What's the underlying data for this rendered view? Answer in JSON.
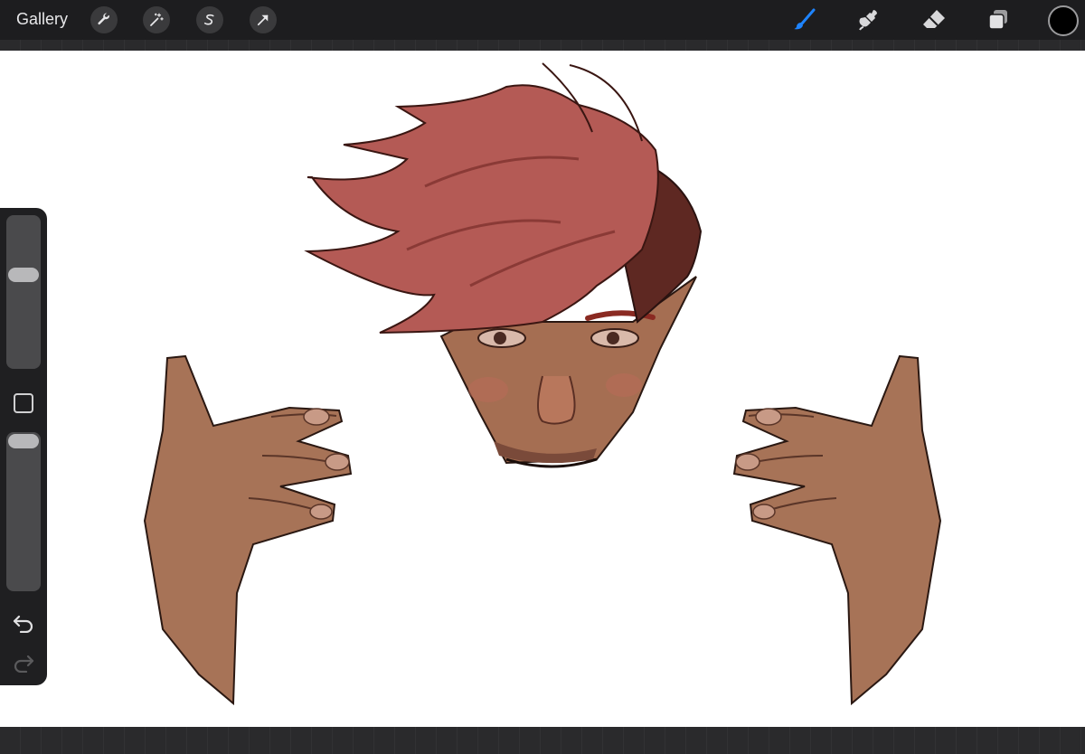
{
  "toolbar": {
    "gallery_label": "Gallery",
    "left_tools": [
      "wrench-icon",
      "magic-wand-icon",
      "selection-icon",
      "transform-arrow-icon"
    ],
    "right_tools": [
      "brush-icon",
      "smudge-icon",
      "eraser-icon",
      "layers-icon"
    ],
    "active_tool": "brush-icon",
    "accent_color": "#1e84ff",
    "current_color": "#000000"
  },
  "sidebar": {
    "brush_size_level": 0.63,
    "opacity_level": 1.0
  },
  "canvas": {
    "background": "#ffffff",
    "subject": [
      "face",
      "left-hand",
      "right-hand"
    ]
  }
}
